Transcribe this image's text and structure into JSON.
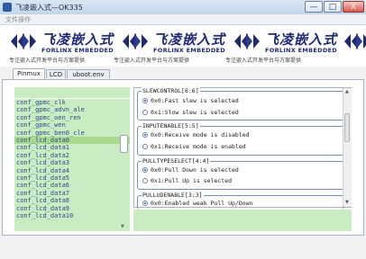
{
  "window": {
    "title": "飞凌嵌入式—OK335",
    "minimize": "—",
    "maximize": "□",
    "close": "X"
  },
  "menu": {
    "file": "文件操作"
  },
  "banner": {
    "brand_cn": "飞凌嵌入式",
    "brand_en": "FORLINX EMBEDDED",
    "slogan": "专注嵌入式开发平台与方案提供"
  },
  "tabs": [
    "Pinmux",
    "LCD",
    "uboot.env"
  ],
  "pins": [
    "conf_gpmc_clk",
    "conf_gpmc_advn_ale",
    "conf_gpmc_oen_ren",
    "conf_gpmc_wen",
    "conf_gpmc_ben0_cle",
    "conf_lcd_data0",
    "conf_lcd_data1",
    "conf_lcd_data2",
    "conf_lcd_data3",
    "conf_lcd_data4",
    "conf_lcd_data5",
    "conf_lcd_data6",
    "conf_lcd_data7",
    "conf_lcd_data8",
    "conf_lcd_data9",
    "conf_lcd_data10"
  ],
  "selected_pin": "conf_lcd_data0",
  "groups": [
    {
      "title": "SLEWCONTROL[6:6]",
      "options": [
        {
          "label": "0x0:Fast slew is selected",
          "checked": true
        },
        {
          "label": "0x1:Slow slew is selected",
          "checked": false
        }
      ]
    },
    {
      "title": "INPUTENABLE[5:5]",
      "options": [
        {
          "label": "0x0:Receive mode is disabled",
          "checked": true
        },
        {
          "label": "0x1:Receive mode is enabled",
          "checked": false
        }
      ]
    },
    {
      "title": "PULLTYPESELECT[4:4]",
      "options": [
        {
          "label": "0x0:Pull Down is selected",
          "checked": true
        },
        {
          "label": "0x1:Pull Up is selected",
          "checked": false
        }
      ]
    },
    {
      "title": "PULLUDENABLE[3:3]",
      "options": [
        {
          "label": "0x0:Enabled weak Pull Up/Down",
          "checked": true
        }
      ]
    }
  ]
}
